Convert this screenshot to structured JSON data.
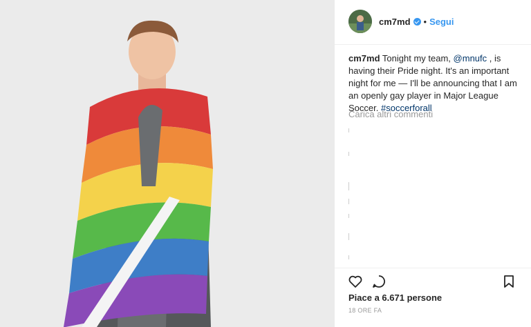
{
  "post": {
    "username": "cm7md",
    "follow_label": "Segui",
    "separator": "•",
    "caption": {
      "username": "cm7md",
      "text_1": "Tonight my team,",
      "mention": "@mnufc",
      "text_2": ", is having their Pride night. It's an important night for me — I'll be announcing that I am an openly gay player in Major League Soccer.",
      "hashtag": "#soccerforall"
    },
    "load_more": "Carica altri commenti",
    "likes": "Piace a 6.671 persone",
    "timestamp": "18 ORE FA"
  },
  "icons": {
    "verified": "verified-badge-icon",
    "like": "heart-icon",
    "comment": "comment-icon",
    "save": "bookmark-icon"
  },
  "colors": {
    "link": "#3897f0",
    "text": "#262626",
    "muted": "#999999",
    "flag": [
      "#d93a3a",
      "#ef8a3a",
      "#f4d24b",
      "#57b94a",
      "#3e7ec7",
      "#8a4ab8"
    ]
  }
}
